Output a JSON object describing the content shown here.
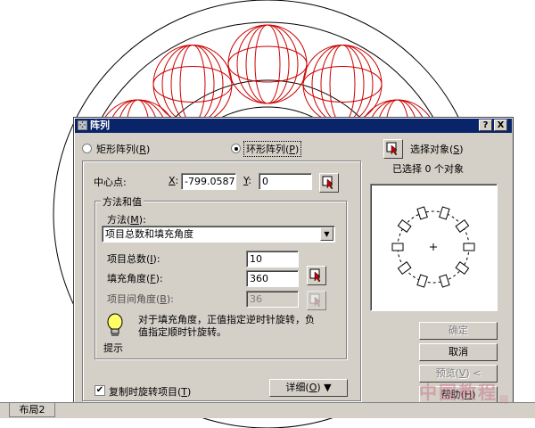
{
  "dialog": {
    "title": "阵列",
    "help_btn": "?",
    "close_btn": "X"
  },
  "mode": {
    "rect": {
      "label": "矩形阵列",
      "key": "R",
      "selected": false
    },
    "polar": {
      "label": "环形阵列",
      "key": "P",
      "selected": true
    }
  },
  "select": {
    "button_label": "选择对象",
    "key": "S",
    "status": "已选择 0 个对象"
  },
  "center": {
    "label": "中心点:",
    "x_label": "X",
    "x_value": "-799.0587",
    "y_label": "Y",
    "y_value": "0"
  },
  "method_group": {
    "title": "方法和值",
    "method_label": "方法",
    "method_key": "M",
    "method_value": "项目总数和填充角度",
    "total_label": "项目总数",
    "total_key": "I",
    "total_value": "10",
    "fill_label": "填充角度",
    "fill_key": "F",
    "fill_value": "360",
    "between_label": "项目间角度",
    "between_key": "B",
    "between_value": "36",
    "tip_text_line1": "对于填充角度，正值指定逆时针旋转，负",
    "tip_text_line2": "值指定顺时针旋转。",
    "tip_label": "提示"
  },
  "options": {
    "rotate_label": "复制时旋转项目",
    "rotate_key": "T",
    "rotate_checked": true,
    "details_label": "详细",
    "details_key": "O"
  },
  "buttons": {
    "ok": "确定",
    "cancel": "取消",
    "preview": "预览",
    "preview_key": "V",
    "help": "帮助",
    "help_key": "H"
  },
  "tabs": {
    "layout2": "布局2"
  },
  "watermark": {
    "text": "中国教程",
    "small": "网"
  },
  "colors": {
    "titlebar": "#0a246a",
    "dialog_bg": "#d4d0c8",
    "drawing_red": "#cc0000"
  }
}
